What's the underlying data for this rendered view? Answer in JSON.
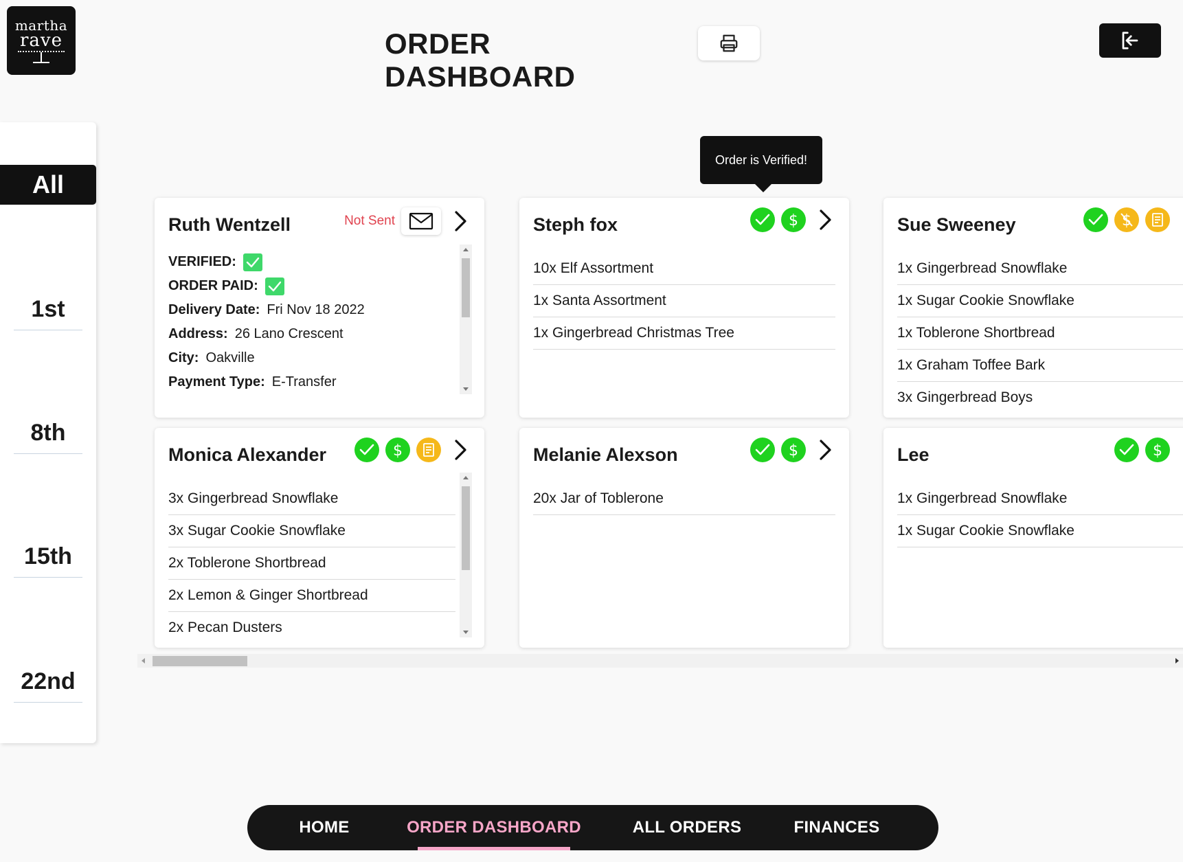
{
  "logo": {
    "line1": "martha",
    "line2": "rave"
  },
  "header": {
    "title": "ORDER DASHBOARD",
    "print_icon": "printer-icon",
    "logout_icon": "logout-icon"
  },
  "sidebar": {
    "items": [
      "All",
      "1st",
      "8th",
      "15th",
      "22nd"
    ],
    "active": "All"
  },
  "tooltip": {
    "text": "Order is Verified!"
  },
  "cards": {
    "ruth": {
      "name": "Ruth Wentzell",
      "status": "Not Sent",
      "details": {
        "verified_label": "VERIFIED:",
        "paid_label": "ORDER PAID:",
        "delivery_label": "Delivery Date:",
        "delivery_value": "Fri Nov 18 2022",
        "address_label": "Address:",
        "address_value": "26 Lano Crescent",
        "city_label": "City:",
        "city_value": "Oakville",
        "payment_label": "Payment Type:",
        "payment_value": "E-Transfer"
      }
    },
    "steph": {
      "name": "Steph fox",
      "items": [
        "10x Elf Assortment",
        "1x Santa Assortment",
        "1x Gingerbread Christmas Tree"
      ]
    },
    "sue": {
      "name": "Sue Sweeney",
      "items": [
        "1x Gingerbread Snowflake",
        "1x Sugar Cookie Snowflake",
        "1x Toblerone Shortbread",
        "1x Graham Toffee Bark",
        "3x Gingerbread Boys"
      ]
    },
    "monica": {
      "name": "Monica Alexander",
      "items": [
        "3x Gingerbread Snowflake",
        "3x Sugar Cookie Snowflake",
        "2x Toblerone Shortbread",
        "2x Lemon & Ginger Shortbread",
        "2x Pecan Dusters"
      ]
    },
    "melanie": {
      "name": "Melanie Alexson",
      "items": [
        "20x Jar of Toblerone"
      ]
    },
    "lee": {
      "name": "Lee",
      "items": [
        "1x Gingerbread Snowflake",
        "1x Sugar Cookie Snowflake"
      ]
    }
  },
  "nav": {
    "home": "HOME",
    "dashboard": "ORDER DASHBOARD",
    "all_orders": "ALL ORDERS",
    "finances": "FINANCES",
    "active": "ORDER DASHBOARD"
  },
  "colors": {
    "verified": "#1fd21f",
    "paid": "#1fd21f",
    "pending": "#f5b81a",
    "not_sent": "#e0434f",
    "nav_active": "#f7a6c8",
    "dark": "#161616"
  }
}
